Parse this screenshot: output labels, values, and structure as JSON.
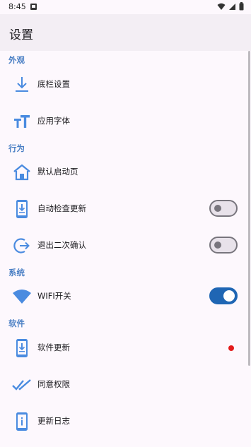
{
  "status": {
    "time": "8:45"
  },
  "appbar": {
    "title": "设置"
  },
  "sections": {
    "appearance": "外观",
    "behavior": "行为",
    "system": "系统",
    "software": "软件"
  },
  "items": {
    "bottom_bar": "底栏设置",
    "app_font": "应用字体",
    "default_page": "默认启动页",
    "auto_check_update": "自动检查更新",
    "exit_confirm": "退出二次确认",
    "wifi_switch": "WIFI开关",
    "software_update": "软件更新",
    "agree_permission": "同意权限",
    "changelog": "更新日志"
  },
  "toggles": {
    "auto_check_update": false,
    "exit_confirm": false,
    "wifi_switch": true
  },
  "colors": {
    "accent": "#1f66b4",
    "icon_blue": "#4a8be0",
    "section": "#4a7fc4",
    "badge": "#e31b1b"
  },
  "icons": {
    "bottom_bar": "download-icon",
    "app_font": "font-size-icon",
    "default_page": "home-icon",
    "auto_check_update": "phone-download-icon",
    "exit_confirm": "exit-icon",
    "wifi_switch": "wifi-icon",
    "software_update": "phone-download-icon",
    "agree_permission": "double-check-icon",
    "changelog": "phone-info-icon"
  }
}
